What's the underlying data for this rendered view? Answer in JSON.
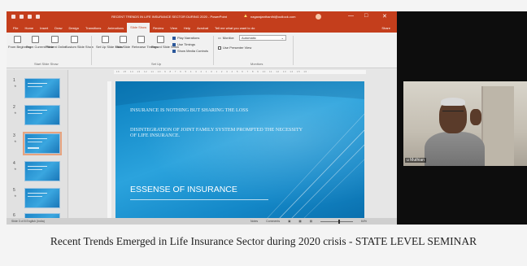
{
  "window": {
    "title": "RECENT TRENDS IN LIFE INSURANCE SECTOR DURING 2020 - PowerPoint",
    "account": "nagarajanthanthi@outlook.com",
    "controls": [
      "—",
      "□",
      "✕"
    ]
  },
  "tabs": [
    {
      "label": "File",
      "active": false
    },
    {
      "label": "Home",
      "active": false
    },
    {
      "label": "Insert",
      "active": false
    },
    {
      "label": "Draw",
      "active": false
    },
    {
      "label": "Design",
      "active": false
    },
    {
      "label": "Transitions",
      "active": false
    },
    {
      "label": "Animations",
      "active": false
    },
    {
      "label": "Slide Show",
      "active": true
    },
    {
      "label": "Review",
      "active": false
    },
    {
      "label": "View",
      "active": false
    },
    {
      "label": "Help",
      "active": false
    },
    {
      "label": "Acrobat",
      "active": false
    },
    {
      "label": "Tell me what you want to do",
      "active": false
    }
  ],
  "share_label": "Share",
  "ribbon": {
    "start": [
      "From Beginning",
      "From Current Slide",
      "Present Online",
      "Custom Slide Show"
    ],
    "start_group": "Start Slide Show",
    "setup": [
      "Set Up Slide Show",
      "Hide Slide",
      "Rehearse Timings",
      "Record Slide Show"
    ],
    "setup_checks": [
      {
        "label": "Play Narrations",
        "checked": true
      },
      {
        "label": "Use Timings",
        "checked": true
      },
      {
        "label": "Show Media Controls",
        "checked": true
      }
    ],
    "setup_group": "Set Up",
    "monitor_label": "Monitor:",
    "monitor_value": "Automatic",
    "presenter_view": "Use Presenter View",
    "monitors_group": "Monitors"
  },
  "ruler_text": "· 16 · 15 · 14 · 13 · 12 · 11 · 10 · 9 · 8 · 7 · 6 · 5 · 4 · 3 · 2 · 1 · 0 · 1 · 2 · 3 · 4 · 5 · 6 · 7 · 8 · 9 · 10 · 11 · 12 · 13 · 14 · 15 · 16 ·",
  "thumbnails": [
    {
      "num": "1"
    },
    {
      "num": "2"
    },
    {
      "num": "3",
      "selected": true
    },
    {
      "num": "4"
    },
    {
      "num": "5"
    },
    {
      "num": "6"
    }
  ],
  "slide": {
    "line1": "INSURANCE IS NOTHING BUT SHARING THE LOSS",
    "line2": "DISINTEGRATION OF JOINT FAMILY SYSTEM PROMPTED THE NECESSITY OF LIFE INSURANCE.",
    "heading": "ESSENSE OF INSURANCE"
  },
  "statusbar": {
    "slide_info": "Slide 3 of 8   English (India)",
    "notes": "Notes",
    "comments": "Comments",
    "zoom": "64%"
  },
  "participant_name": "u Muthian",
  "caption": "Recent Trends Emerged in Life Insurance Sector during 2020 crisis - STATE LEVEL SEMINAR"
}
